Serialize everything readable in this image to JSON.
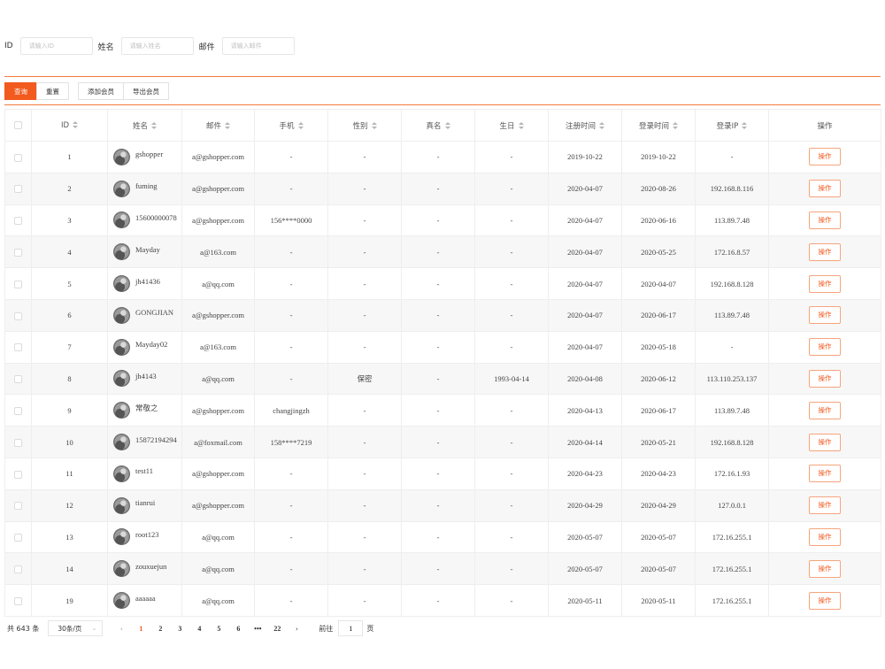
{
  "search": {
    "fields": [
      {
        "label": "ID",
        "placeholder": "请输入ID"
      },
      {
        "label": "姓名",
        "placeholder": "请输入姓名"
      },
      {
        "label": "邮件",
        "placeholder": "请输入邮件"
      }
    ]
  },
  "toolbar": {
    "query_label": "查询",
    "reset_label": "重置",
    "add_label": "添加会员",
    "export_label": "导出会员"
  },
  "table": {
    "columns": [
      "ID",
      "姓名",
      "邮件",
      "手机",
      "性别",
      "真名",
      "生日",
      "注册时间",
      "登录时间",
      "登录IP",
      "操作"
    ],
    "action_label": "操作",
    "rows": [
      {
        "id": "1",
        "name": "gshopper",
        "email": "a@gshopper.com",
        "phone": "-",
        "gender": "-",
        "realname": "-",
        "birthday": "-",
        "reg": "2019-10-22",
        "login": "2019-10-22",
        "ip": "-"
      },
      {
        "id": "2",
        "name": "fuming",
        "email": "a@gshopper.com",
        "phone": "-",
        "gender": "-",
        "realname": "-",
        "birthday": "-",
        "reg": "2020-04-07",
        "login": "2020-08-26",
        "ip": "192.168.8.116"
      },
      {
        "id": "3",
        "name": "15600000078",
        "email": "a@gshopper.com",
        "phone": "156****0000",
        "gender": "-",
        "realname": "-",
        "birthday": "-",
        "reg": "2020-04-07",
        "login": "2020-06-16",
        "ip": "113.89.7.48"
      },
      {
        "id": "4",
        "name": "Mayday",
        "email": "a@163.com",
        "phone": "-",
        "gender": "-",
        "realname": "-",
        "birthday": "-",
        "reg": "2020-04-07",
        "login": "2020-05-25",
        "ip": "172.16.8.57"
      },
      {
        "id": "5",
        "name": "jh41436",
        "email": "a@qq.com",
        "phone": "-",
        "gender": "-",
        "realname": "-",
        "birthday": "-",
        "reg": "2020-04-07",
        "login": "2020-04-07",
        "ip": "192.168.8.128"
      },
      {
        "id": "6",
        "name": "GONGJIAN",
        "email": "a@gshopper.com",
        "phone": "-",
        "gender": "-",
        "realname": "-",
        "birthday": "-",
        "reg": "2020-04-07",
        "login": "2020-06-17",
        "ip": "113.89.7.48"
      },
      {
        "id": "7",
        "name": "Mayday02",
        "email": "a@163.com",
        "phone": "-",
        "gender": "-",
        "realname": "-",
        "birthday": "-",
        "reg": "2020-04-07",
        "login": "2020-05-18",
        "ip": "-"
      },
      {
        "id": "8",
        "name": "jh4143",
        "email": "a@qq.com",
        "phone": "-",
        "gender": "保密",
        "realname": "-",
        "birthday": "1993-04-14",
        "reg": "2020-04-08",
        "login": "2020-06-12",
        "ip": "113.110.253.137"
      },
      {
        "id": "9",
        "name": "常敬之",
        "email": "a@gshopper.com",
        "phone": "changjingzh",
        "gender": "-",
        "realname": "-",
        "birthday": "-",
        "reg": "2020-04-13",
        "login": "2020-06-17",
        "ip": "113.89.7.48"
      },
      {
        "id": "10",
        "name": "15872194294",
        "email": "a@foxmail.com",
        "phone": "158****7219",
        "gender": "-",
        "realname": "-",
        "birthday": "-",
        "reg": "2020-04-14",
        "login": "2020-05-21",
        "ip": "192.168.8.128"
      },
      {
        "id": "11",
        "name": "test11",
        "email": "a@gshopper.com",
        "phone": "-",
        "gender": "-",
        "realname": "-",
        "birthday": "-",
        "reg": "2020-04-23",
        "login": "2020-04-23",
        "ip": "172.16.1.93"
      },
      {
        "id": "12",
        "name": "tianrui",
        "email": "a@gshopper.com",
        "phone": "-",
        "gender": "-",
        "realname": "-",
        "birthday": "-",
        "reg": "2020-04-29",
        "login": "2020-04-29",
        "ip": "127.0.0.1"
      },
      {
        "id": "13",
        "name": "root123",
        "email": "a@qq.com",
        "phone": "-",
        "gender": "-",
        "realname": "-",
        "birthday": "-",
        "reg": "2020-05-07",
        "login": "2020-05-07",
        "ip": "172.16.255.1"
      },
      {
        "id": "14",
        "name": "zouxuejun",
        "email": "a@qq.com",
        "phone": "-",
        "gender": "-",
        "realname": "-",
        "birthday": "-",
        "reg": "2020-05-07",
        "login": "2020-05-07",
        "ip": "172.16.255.1"
      },
      {
        "id": "19",
        "name": "aaaaaa",
        "email": "a@qq.com",
        "phone": "-",
        "gender": "-",
        "realname": "-",
        "birthday": "-",
        "reg": "2020-05-11",
        "login": "2020-05-11",
        "ip": "172.16.255.1"
      }
    ]
  },
  "pagination": {
    "total_text": "共 643 条",
    "page_size": "30条/页",
    "pages": [
      "1",
      "2",
      "3",
      "4",
      "5",
      "6",
      "•••",
      "22"
    ],
    "current": "1",
    "goto_prefix": "前往",
    "goto_value": "1",
    "goto_suffix": "页"
  },
  "colors": {
    "accent": "#f25a1e",
    "rule": "#f47a3d"
  },
  "icons": [
    "sort-icon",
    "avatar",
    "chevron-left-icon",
    "chevron-right-icon",
    "chevron-down-icon"
  ]
}
